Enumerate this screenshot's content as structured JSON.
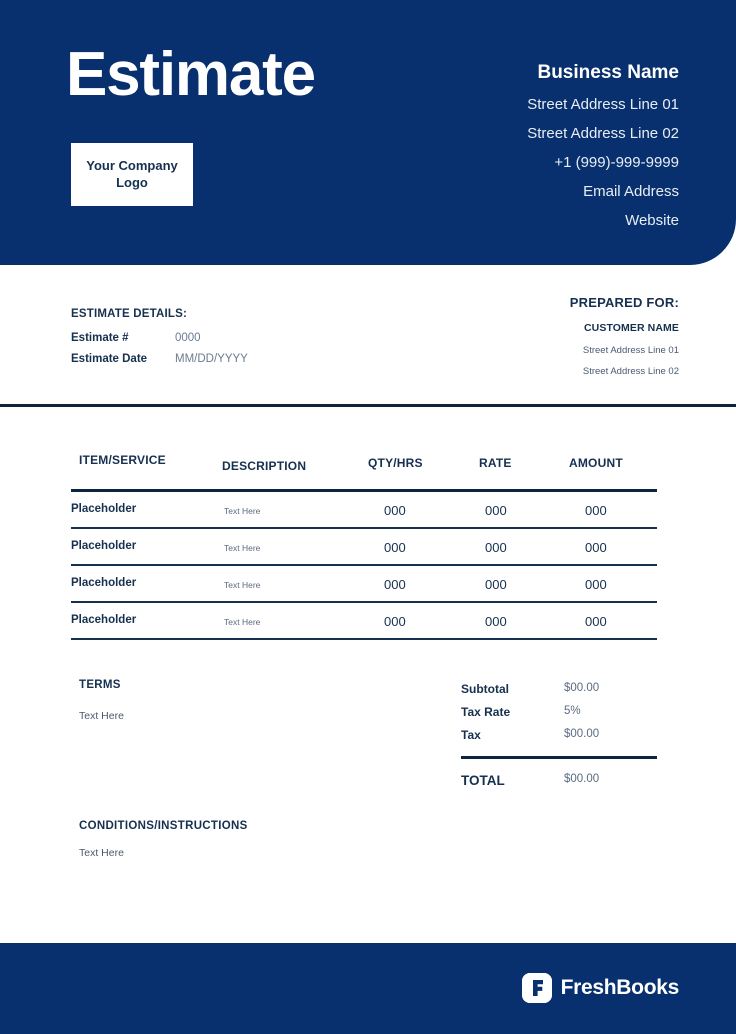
{
  "header": {
    "doc_title": "Estimate",
    "logo_placeholder": "Your Company Logo",
    "logo_line_1": "Your Company",
    "logo_line_2": "Logo",
    "business_name": "Business Name",
    "address_line_1": "Street Address Line 01",
    "address_line_2": "Street Address Line 02",
    "phone": "+1 (999)-999-9999",
    "email": "Email Address",
    "website": "Website",
    "bg_color": "#08306e"
  },
  "estimate_details": {
    "title": "ESTIMATE DETAILS:",
    "rows": [
      {
        "label": "Estimate #",
        "value": "0000"
      },
      {
        "label": "Estimate Date",
        "value": "MM/DD/YYYY"
      }
    ]
  },
  "prepared_for": {
    "title": "PREPARED FOR:",
    "customer_name": "CUSTOMER NAME",
    "address_line_1": "Street Address Line 01",
    "address_line_2": "Street Address Line 02"
  },
  "table": {
    "columns": [
      "ITEM/SERVICE",
      "DESCRIPTION",
      "QTY/HRS",
      "RATE",
      "AMOUNT"
    ],
    "rows": [
      {
        "item": "Placeholder",
        "description": "Text Here",
        "qty": "000",
        "rate": "000",
        "amount": "000"
      },
      {
        "item": "Placeholder",
        "description": "Text Here",
        "qty": "000",
        "rate": "000",
        "amount": "000"
      },
      {
        "item": "Placeholder",
        "description": "Text Here",
        "qty": "000",
        "rate": "000",
        "amount": "000"
      },
      {
        "item": "Placeholder",
        "description": "Text Here",
        "qty": "000",
        "rate": "000",
        "amount": "000"
      }
    ]
  },
  "terms": {
    "title": "TERMS",
    "body": "Text Here"
  },
  "totals": {
    "rows": [
      {
        "label": "Subtotal",
        "value": "$00.00"
      },
      {
        "label": "Tax Rate",
        "value": "5%"
      },
      {
        "label": "Tax",
        "value": "$00.00"
      }
    ],
    "total_label": "TOTAL",
    "total_value": "$00.00"
  },
  "conditions": {
    "title": "CONDITIONS/INSTRUCTIONS",
    "body": "Text Here"
  },
  "footer": {
    "brand_name": "FreshBooks",
    "brand_mark": "freshbooks-f-icon",
    "bg_color": "#08306e"
  }
}
